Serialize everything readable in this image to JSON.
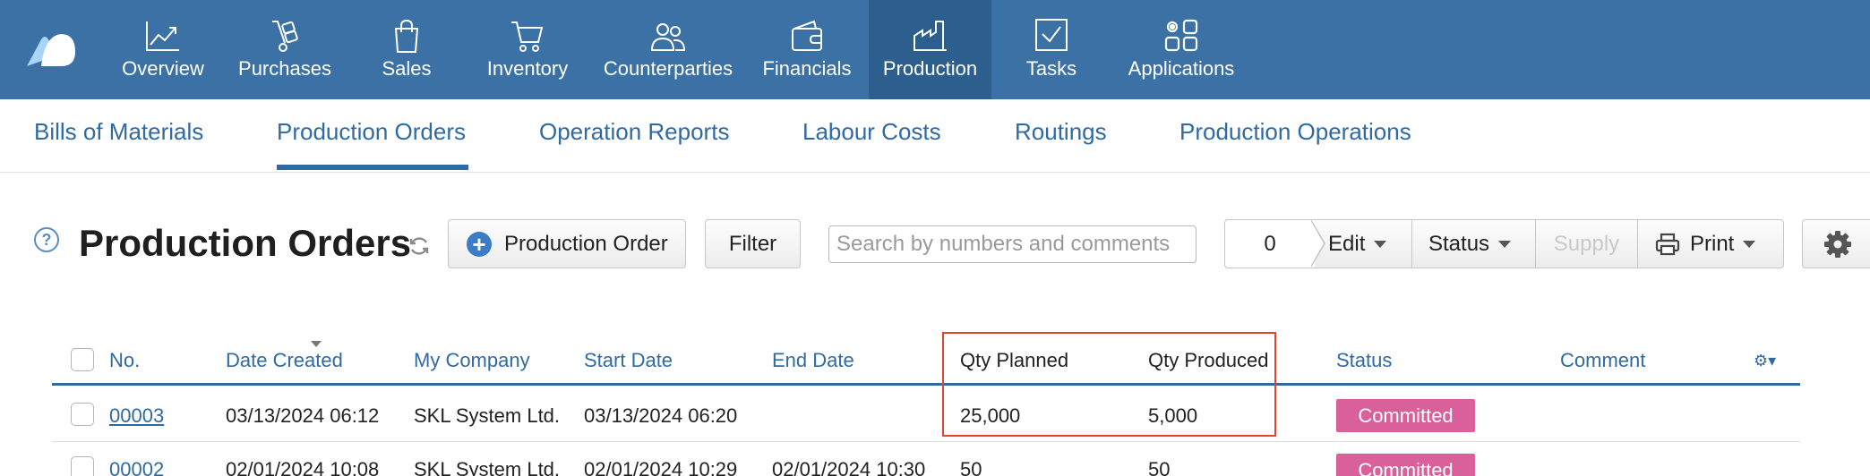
{
  "nav": {
    "items": [
      {
        "label": "Overview",
        "icon": "chart-line-icon",
        "active": false
      },
      {
        "label": "Purchases",
        "icon": "hand-truck-icon",
        "active": false
      },
      {
        "label": "Sales",
        "icon": "shopping-bag-icon",
        "active": false
      },
      {
        "label": "Inventory",
        "icon": "cart-icon",
        "active": false
      },
      {
        "label": "Counterparties",
        "icon": "people-icon",
        "active": false
      },
      {
        "label": "Financials",
        "icon": "wallet-icon",
        "active": false
      },
      {
        "label": "Production",
        "icon": "factory-icon",
        "active": true
      },
      {
        "label": "Tasks",
        "icon": "checkbox-icon",
        "active": false
      },
      {
        "label": "Applications",
        "icon": "apps-icon",
        "active": false
      }
    ]
  },
  "subtabs": {
    "items": [
      {
        "label": "Bills of Materials",
        "active": false
      },
      {
        "label": "Production Orders",
        "active": true
      },
      {
        "label": "Operation Reports",
        "active": false
      },
      {
        "label": "Labour Costs",
        "active": false
      },
      {
        "label": "Routings",
        "active": false
      },
      {
        "label": "Production Operations",
        "active": false
      }
    ]
  },
  "toolbar": {
    "help": "?",
    "title": "Production Orders",
    "add_label": "Production Order",
    "filter_label": "Filter",
    "search_placeholder": "Search by numbers and comments",
    "selected_count": "0",
    "edit_label": "Edit",
    "status_label": "Status",
    "supply_label": "Supply",
    "print_label": "Print"
  },
  "table": {
    "columns": {
      "no": "No.",
      "date_created": "Date Created",
      "company": "My Company",
      "start": "Start Date",
      "end": "End Date",
      "qty_planned": "Qty Planned",
      "qty_produced": "Qty Produced",
      "status": "Status",
      "comment": "Comment"
    },
    "rows": [
      {
        "no": "00003",
        "date_created": "03/13/2024 06:12",
        "company": "SKL System Ltd.",
        "start": "03/13/2024 06:20",
        "end": "",
        "qty_planned": "25,000",
        "qty_produced": "5,000",
        "status": "Committed",
        "comment": ""
      },
      {
        "no": "00002",
        "date_created": "02/01/2024 10:08",
        "company": "SKL System Ltd.",
        "start": "02/01/2024 10:29",
        "end": "02/01/2024 10:30",
        "qty_planned": "50",
        "qty_produced": "50",
        "status": "Committed",
        "comment": ""
      }
    ]
  },
  "colors": {
    "nav_bg": "#3b71a4",
    "accent": "#2f6aa3",
    "status_committed": "#d9609a",
    "highlight": "#e2452f"
  }
}
